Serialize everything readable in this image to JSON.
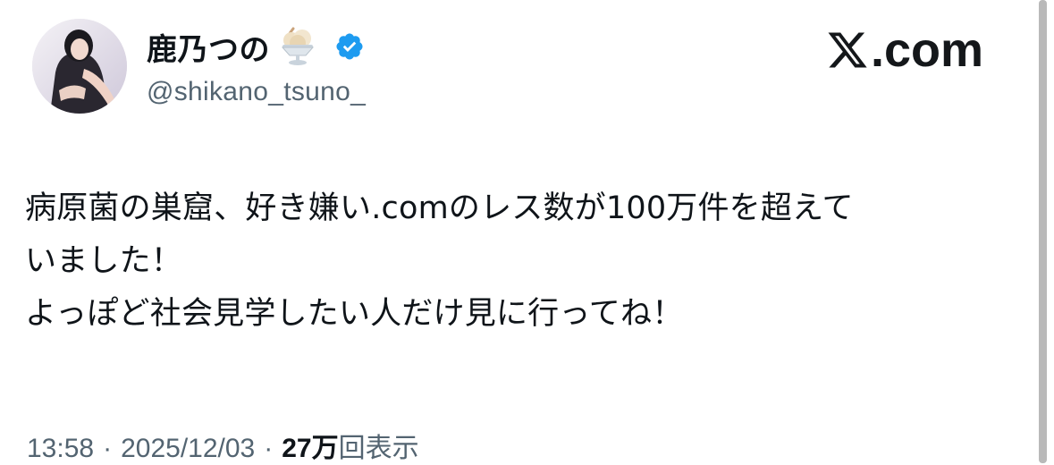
{
  "author": {
    "display_name": "鹿乃つの",
    "handle": "@shikano_tsuno_",
    "name_emoji": "ice-cream-sundae-icon",
    "verified_icon": "verified-badge-icon"
  },
  "brand": {
    "logo_icon": "x-logo-icon",
    "domain_suffix": ".com"
  },
  "tweet": {
    "lines": [
      "病原菌の巣窟、好き嫌い.comのレス数が100万件を超えて",
      "いました！",
      "よっぽど社会見学したい人だけ見に行ってね！"
    ]
  },
  "meta": {
    "time": "13:58",
    "separator": "·",
    "date": "2025/12/03",
    "views_count": "27万",
    "views_label": "回表示"
  },
  "colors": {
    "text": "#0f1419",
    "secondary": "#536471",
    "verified": "#1d9bf0"
  }
}
